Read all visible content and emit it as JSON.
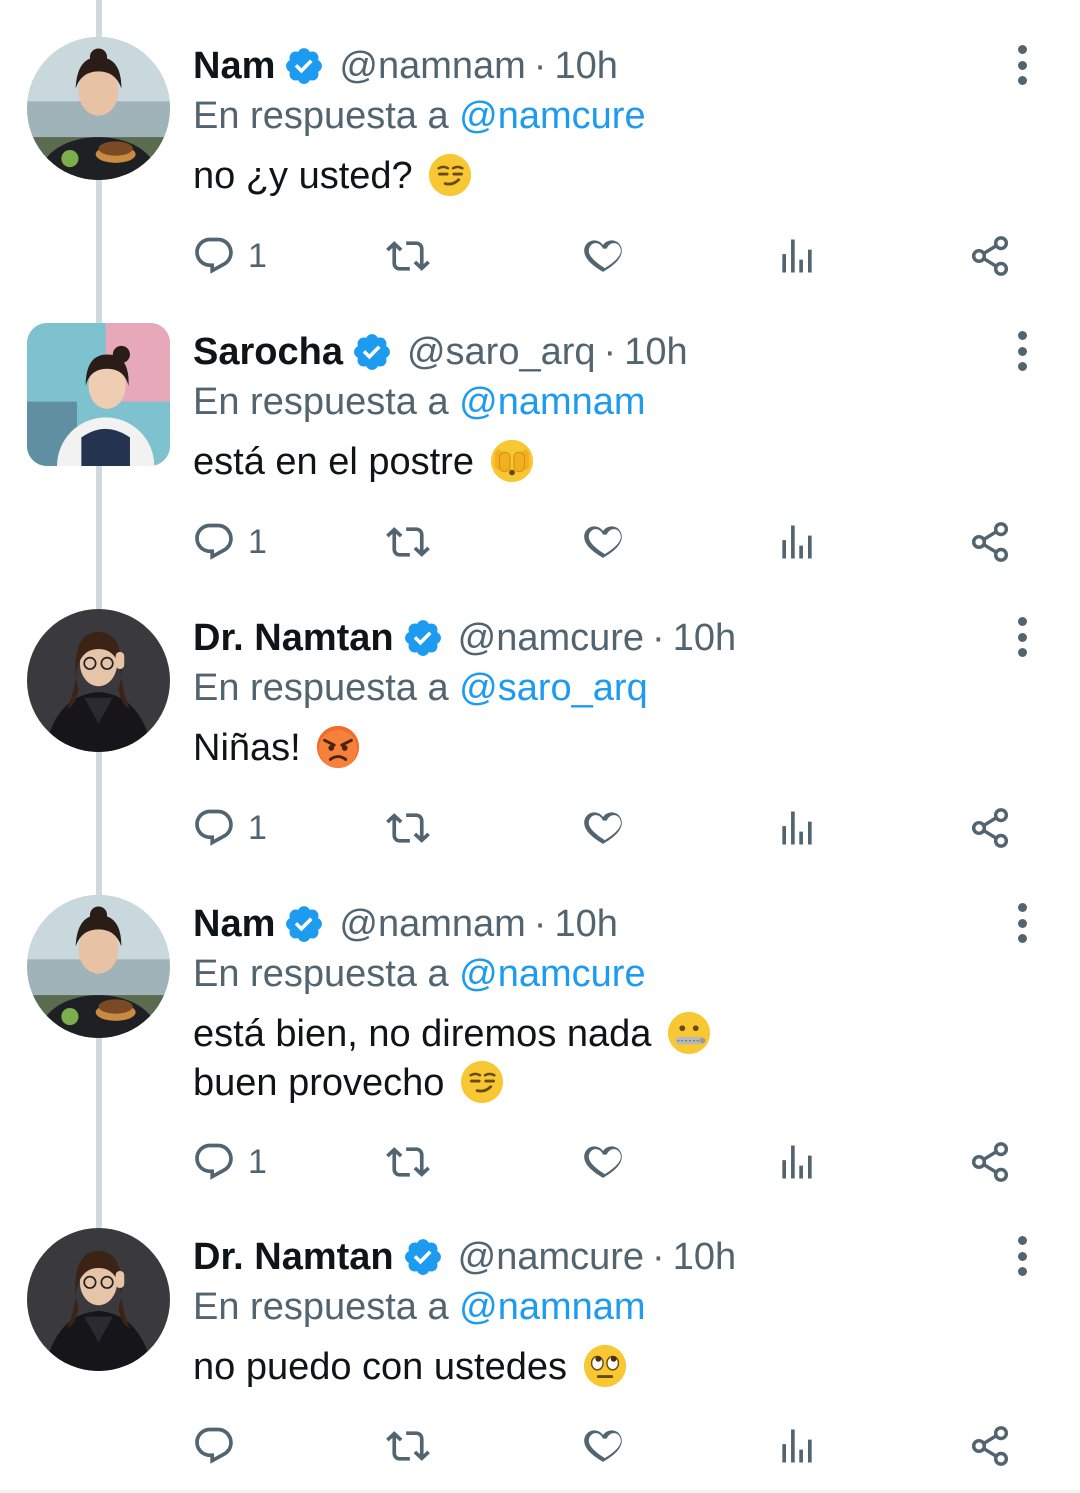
{
  "theme": {
    "name_color": "#0f1419",
    "secondary_color": "#536471",
    "link_color": "#1d9bf0",
    "verified_color": "#1d9bf0"
  },
  "tweets": [
    {
      "name": "Nam",
      "handle": "@namnam",
      "sep": "·",
      "time": "10h",
      "reply_prefix": "En respuesta a",
      "reply_to": "@namcure",
      "lines": [
        "no ¿y usted?"
      ],
      "emojis": [
        "smirk-emoji"
      ],
      "avatar": "nam-avatar",
      "reply_count": "1"
    },
    {
      "name": "Sarocha",
      "handle": "@saro_arq",
      "sep": "·",
      "time": "10h",
      "reply_prefix": "En respuesta a",
      "reply_to": "@namnam",
      "lines": [
        "está en el postre"
      ],
      "emojis": [
        "face-peeking-emoji"
      ],
      "avatar": "sarocha-avatar",
      "reply_count": "1"
    },
    {
      "name": "Dr. Namtan",
      "handle": "@namcure",
      "sep": "·",
      "time": "10h",
      "reply_prefix": "En respuesta a",
      "reply_to": "@saro_arq",
      "lines": [
        "Niñas!"
      ],
      "emojis": [
        "angry-face-emoji"
      ],
      "avatar": "namtan-avatar",
      "reply_count": "1"
    },
    {
      "name": "Nam",
      "handle": "@namnam",
      "sep": "·",
      "time": "10h",
      "reply_prefix": "En respuesta a",
      "reply_to": "@namcure",
      "lines": [
        "está bien, no diremos nada",
        "buen provecho"
      ],
      "emojis": [
        "zipper-mouth-emoji",
        "smirk-emoji"
      ],
      "avatar": "nam-avatar",
      "reply_count": "1"
    },
    {
      "name": "Dr. Namtan",
      "handle": "@namcure",
      "sep": "·",
      "time": "10h",
      "reply_prefix": "En respuesta a",
      "reply_to": "@namnam",
      "lines": [
        "no puedo con ustedes"
      ],
      "emojis": [
        "eye-roll-emoji"
      ],
      "avatar": "namtan-avatar",
      "reply_count": ""
    }
  ],
  "icons": {
    "verified": "verified-badge-icon",
    "more": "more-options-icon",
    "reply": "reply-icon",
    "retweet": "retweet-icon",
    "like": "heart-icon",
    "views": "views-chart-icon",
    "share": "share-icon"
  }
}
